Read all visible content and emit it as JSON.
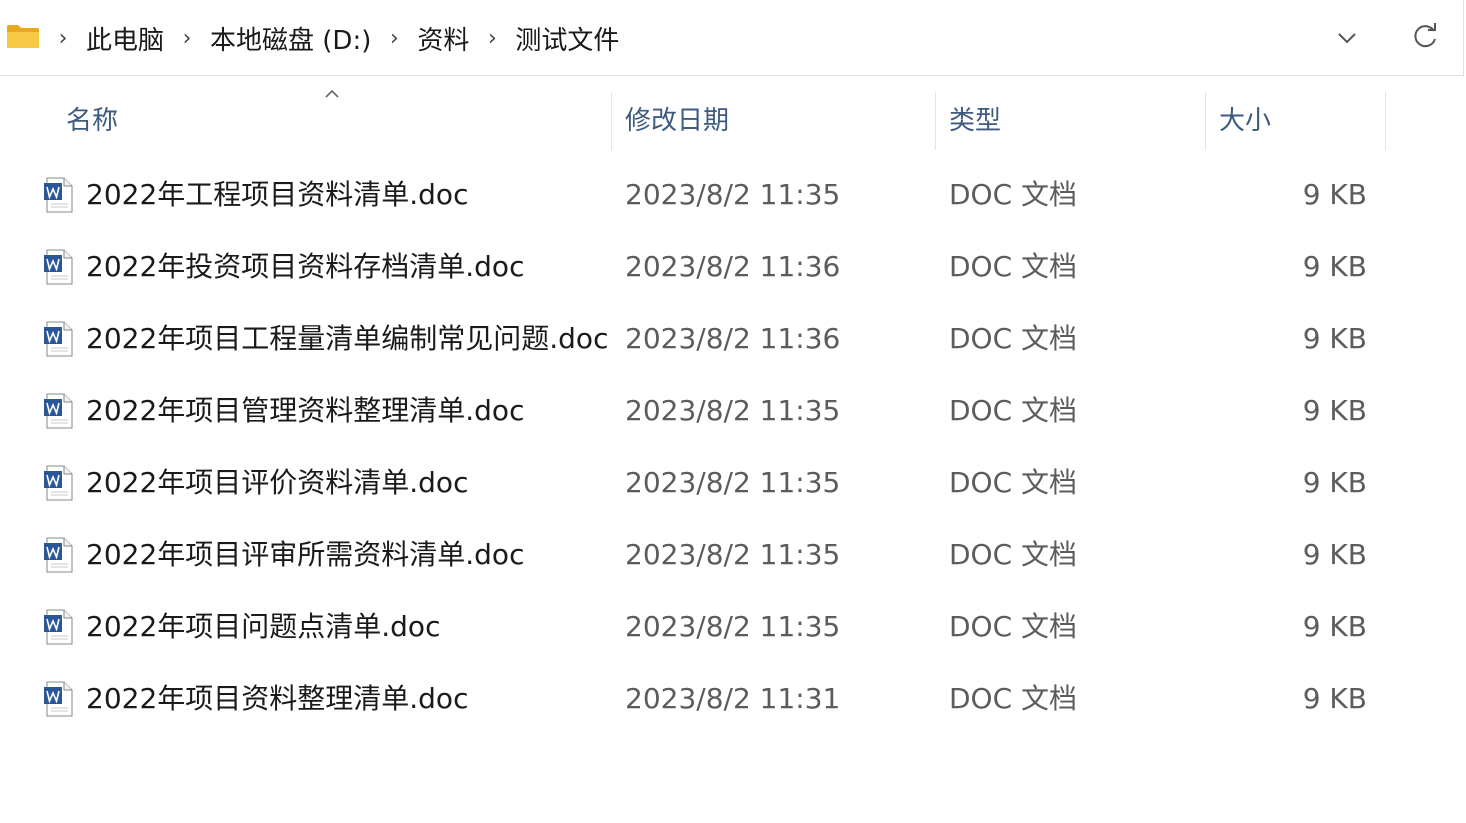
{
  "breadcrumb": {
    "items": [
      "此电脑",
      "本地磁盘 (D:)",
      "资料",
      "测试文件"
    ],
    "separator": "›"
  },
  "columns": {
    "name": "名称",
    "modified": "修改日期",
    "type": "类型",
    "size": "大小"
  },
  "icons": {
    "folder": "folder-icon",
    "dropdown": "chevron-down-icon",
    "refresh": "refresh-icon",
    "sort": "sort-ascending-icon",
    "file": "word-document-icon"
  },
  "colors": {
    "header_text": "#3d5a80",
    "folder_yellow": "#f5c542",
    "word_blue": "#2b5797"
  },
  "files": [
    {
      "name": "2022年工程项目资料清单.doc",
      "modified": "2023/8/2 11:35",
      "type": "DOC 文档",
      "size": "9 KB"
    },
    {
      "name": "2022年投资项目资料存档清单.doc",
      "modified": "2023/8/2 11:36",
      "type": "DOC 文档",
      "size": "9 KB"
    },
    {
      "name": "2022年项目工程量清单编制常见问题.doc",
      "modified": "2023/8/2 11:36",
      "type": "DOC 文档",
      "size": "9 KB"
    },
    {
      "name": "2022年项目管理资料整理清单.doc",
      "modified": "2023/8/2 11:35",
      "type": "DOC 文档",
      "size": "9 KB"
    },
    {
      "name": "2022年项目评价资料清单.doc",
      "modified": "2023/8/2 11:35",
      "type": "DOC 文档",
      "size": "9 KB"
    },
    {
      "name": "2022年项目评审所需资料清单.doc",
      "modified": "2023/8/2 11:35",
      "type": "DOC 文档",
      "size": "9 KB"
    },
    {
      "name": "2022年项目问题点清单.doc",
      "modified": "2023/8/2 11:35",
      "type": "DOC 文档",
      "size": "9 KB"
    },
    {
      "name": "2022年项目资料整理清单.doc",
      "modified": "2023/8/2 11:31",
      "type": "DOC 文档",
      "size": "9 KB"
    }
  ]
}
